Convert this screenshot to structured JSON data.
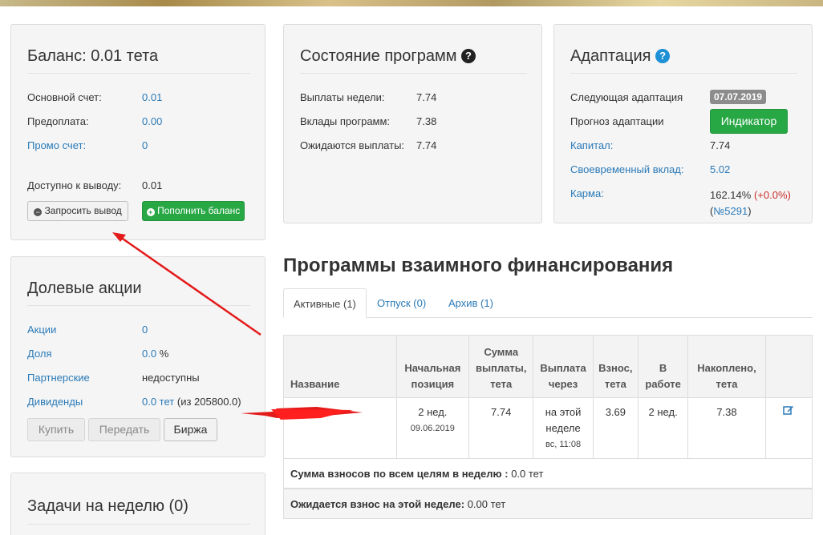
{
  "balance": {
    "title": "Баланс: 0.01 тета",
    "rows": [
      {
        "label": "Основной счет:",
        "value": "0.01"
      },
      {
        "label": "Предоплата:",
        "value": "0.00"
      },
      {
        "label": "Промо счет:",
        "value": "0"
      }
    ],
    "available_label": "Доступно к выводу:",
    "available_value": "0.01",
    "withdraw_button": "Запросить вывод",
    "topup_button": "Пополнить баланс"
  },
  "shares": {
    "title": "Долевые акции",
    "shares_label": "Акции",
    "shares_value": "0",
    "part_label": "Доля",
    "part_value": "0.0",
    "part_unit": "%",
    "partner_label": "Партнерские",
    "partner_value": "недоступны",
    "dividends_label": "Дивиденды",
    "dividends_value": "0.0 тет",
    "dividends_extra": "(из 205800.0)",
    "buy_button": "Купить",
    "transfer_button": "Передать",
    "exchange_button": "Биржа"
  },
  "tasks": {
    "title": "Задачи на неделю (0)"
  },
  "program_state": {
    "title": "Состояние программ",
    "rows": [
      {
        "label": "Выплаты недели:",
        "value": "7.74"
      },
      {
        "label": "Вклады программ:",
        "value": "7.38"
      },
      {
        "label": "Ожидаются выплаты:",
        "value": "7.74"
      }
    ]
  },
  "adaptation": {
    "title": "Адаптация",
    "next_label": "Следующая адаптация",
    "next_date": "07.07.2019",
    "forecast_label": "Прогноз адаптации",
    "indicator_button": "Индикатор",
    "capital_label": "Капитал:",
    "capital_value": "7.74",
    "timely_label": "Своевременный вклад:",
    "timely_value": "5.02",
    "karma_label": "Карма:",
    "karma_value": "162.14%",
    "karma_delta": "(+0.0%)",
    "karma_number": "№5291"
  },
  "programs": {
    "heading": "Программы взаимного финансирования",
    "tabs": [
      "Активные (1)",
      "Отпуск (0)",
      "Архив (1)"
    ],
    "columns": [
      "Название",
      "Начальная позиция",
      "Сумма выплаты, тета",
      "Выплата через",
      "Взнос, тета",
      "В работе",
      "Накоплено, тета"
    ],
    "rows": [
      {
        "name": "",
        "position": "2 нед.",
        "position_date": "09.06.2019",
        "payout": "7.74",
        "payout_in": "на этой неделе",
        "payout_in_time": "вс, 11:08",
        "fee": "3.69",
        "in_work": "2 нед.",
        "accumulated": "7.38"
      }
    ],
    "sum_label": "Сумма взносов по всем целям в неделю :",
    "sum_value": "0.0 тет",
    "expected_label": "Ожидается взнос на этой неделе:",
    "expected_value": "0.00 тет"
  },
  "colors": {
    "link": "#2a7ab8",
    "success": "#28a745",
    "annotation": "#e31a1a"
  }
}
